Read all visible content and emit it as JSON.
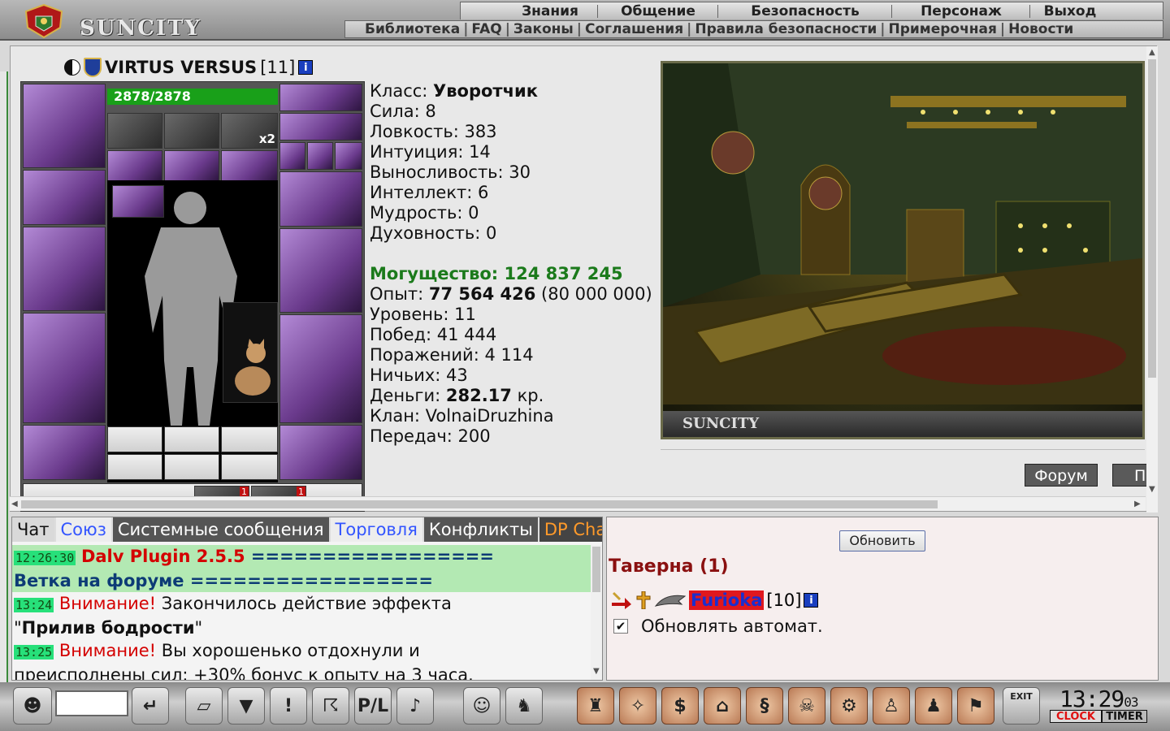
{
  "topbar": {
    "logo_text": "SUNCITY",
    "menu_main": [
      "Знания",
      "Общение",
      "Безопасность",
      "Персонаж",
      "Выход"
    ],
    "menu_links": [
      "Библиотека",
      "FAQ",
      "Законы",
      "Соглашения",
      "Правила безопасности",
      "Примерочная",
      "Новости"
    ]
  },
  "character": {
    "name": "VIRTUS VERSUS",
    "level_tag": "[11]",
    "info_glyph": "i",
    "hp": "2878/2878",
    "stack_badge": "x2",
    "belt_badges": [
      "1",
      "1"
    ]
  },
  "stats": {
    "class_label": "Класс: ",
    "class_value": "Уворотчик",
    "sila": "Сила: 8",
    "lovkost": "Ловкость: 383",
    "intuition": "Интуиция: 14",
    "vynoslivost": "Выносливость: 30",
    "intellekt": "Интеллект: 6",
    "mudrost": "Мудрость: 0",
    "duh": "Духовность: 0",
    "power": "Могущество: 124 837 245",
    "exp_label": "Опыт: ",
    "exp_value": "77 564 426",
    "exp_next": " (80 000 000)",
    "level": "Уровень: 11",
    "wins": "Побед: 41 444",
    "losses": "Поражений: 4 114",
    "draws": "Ничьих: 43",
    "money_label": "Деньги: ",
    "money_value": "282.17",
    "money_unit": " кр.",
    "clan": "Клан: VolnaiDruzhina",
    "transfers": "Передач: 200"
  },
  "location": {
    "watermark": "SUNCITY",
    "forum_button": "Форум",
    "next_button": "П"
  },
  "chat": {
    "tabs": [
      "Чат",
      "Союз",
      "Системные сообщения",
      "Торговля",
      "Конфликты",
      "DP Chat"
    ],
    "line1_time": "12:26:30",
    "line1_plugin": "Dalv Plugin 2.5.5",
    "line1_eq": "  =================",
    "line2_text": "Ветка на форуме =================",
    "line3_time": "13:24",
    "line3_warn": "Внимание!",
    "line3_text": " Закончилось действие эффекта",
    "line4_open": "\"",
    "line4_bold": "Прилив бодрости",
    "line4_close": "\"",
    "line5_time": "13:25",
    "line5_warn": "Внимание!",
    "line5_text": " Вы хорошенько отдохнули и",
    "line6_text": "преисполнены сил: +30% бонус к опыту на 3 часа."
  },
  "room": {
    "refresh_button": "Обновить",
    "title": "Таверна (1)",
    "user_name": "Furioka",
    "user_level": "[10]",
    "info_glyph": "i",
    "auto_refresh_label": "Обновлять автомат."
  },
  "bottombar": {
    "clock_time": "13:29",
    "clock_seconds": "03",
    "clock_button": "CLOCK",
    "timer_button": "TIMER",
    "exit_label": "EXIT"
  },
  "colors": {
    "hp_bar": "#19a019",
    "power_text": "#1b7a1b",
    "warning_text": "#d40000",
    "chat_highlight": "#b3e9b3",
    "timestamp_bg": "#27e07a",
    "room_title": "#8a1010",
    "username_bg": "#e0181e",
    "username_text": "#1a2fcf",
    "dp_chat_tab": "#ff9a2a"
  }
}
